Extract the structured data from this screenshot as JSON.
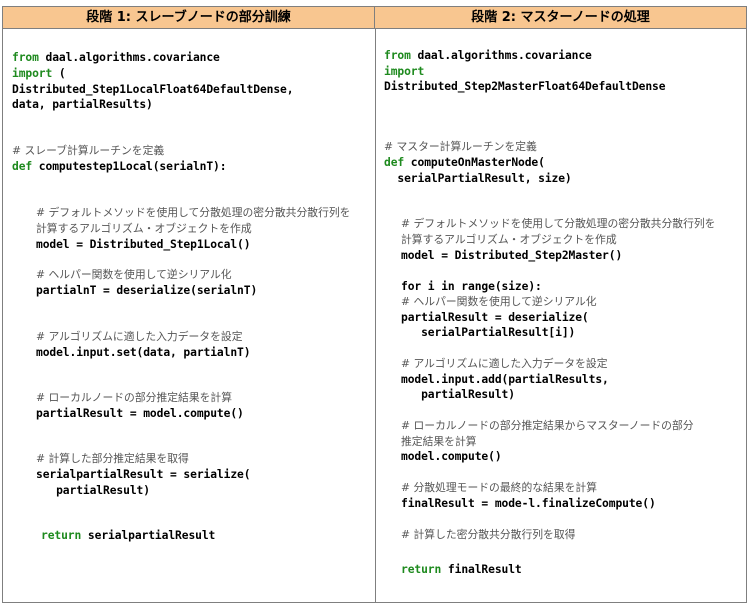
{
  "headers": {
    "left": "段階 1: スレーブノードの部分訓練",
    "right": "段階 2: マスターノードの処理"
  },
  "left": {
    "import_kw_from": "from",
    "import_module": " daal.algorithms.covariance",
    "import_kw_import": "import",
    "import_paren": " (",
    "import_line3": "Distributed_Step1LocalFloat64DefaultDense,",
    "import_line4": "data, partialResults)",
    "comment_define": "# スレーブ計算ルーチンを定義",
    "def_kw": "def",
    "def_sig": " computestep1Local(serialnT):",
    "comment_model_1": "# デフォルトメソッドを使用して分散処理の密分散共分散行列を",
    "comment_model_2": "計算するアルゴリズム・オブジェクトを作成",
    "code_model": "model = Distributed_Step1Local()",
    "comment_deser": "# ヘルパー関数を使用して逆シリアル化",
    "code_deser": "partialnT = deserialize(serialnT)",
    "comment_input": "# アルゴリズムに適した入力データを設定",
    "code_input": "model.input.set(data, partialnT)",
    "comment_compute": "# ローカルノードの部分推定結果を計算",
    "code_compute": "partialResult = model.compute()",
    "comment_serial": "# 計算した部分推定結果を取得",
    "code_serial_1": "serialpartialResult = serialize(",
    "code_serial_2": "   partialResult)",
    "return_kw": "return",
    "return_val": " serialpartialResult"
  },
  "right": {
    "import_kw_from": "from",
    "import_module": " daal.algorithms.covariance",
    "import_kw_import": "import",
    "import_line3": "Distributed_Step2MasterFloat64DefaultDense",
    "comment_define": "# マスター計算ルーチンを定義",
    "def_kw": "def",
    "def_sig": " computeOnMasterNode(",
    "def_sig_2": "  serialPartialResult, size)",
    "comment_model_1": "# デフォルトメソッドを使用して分散処理の密分散共分散行列を",
    "comment_model_2": "計算するアルゴリズム・オブジェクトを作成",
    "code_model": "model = Distributed_Step2Master()",
    "code_for": "for i in range(size):",
    "comment_deser": "# ヘルパー関数を使用して逆シリアル化",
    "code_deser_1": "partialResult = deserialize(",
    "code_deser_2": "   serialPartialResult[i])",
    "comment_input": "# アルゴリズムに適した入力データを設定",
    "code_input_1": "model.input.add(partialResults,",
    "code_input_2": "   partialResult)",
    "comment_compute_1": "# ローカルノードの部分推定結果からマスターノードの部分",
    "comment_compute_2": "推定結果を計算",
    "code_compute": "model.compute()",
    "comment_final": "# 分散処理モードの最終的な結果を計算",
    "code_final": "finalResult = mode-l.finalizeCompute()",
    "comment_get": "# 計算した密分散共分散行列を取得",
    "return_kw": "return",
    "return_val": " finalResult"
  }
}
